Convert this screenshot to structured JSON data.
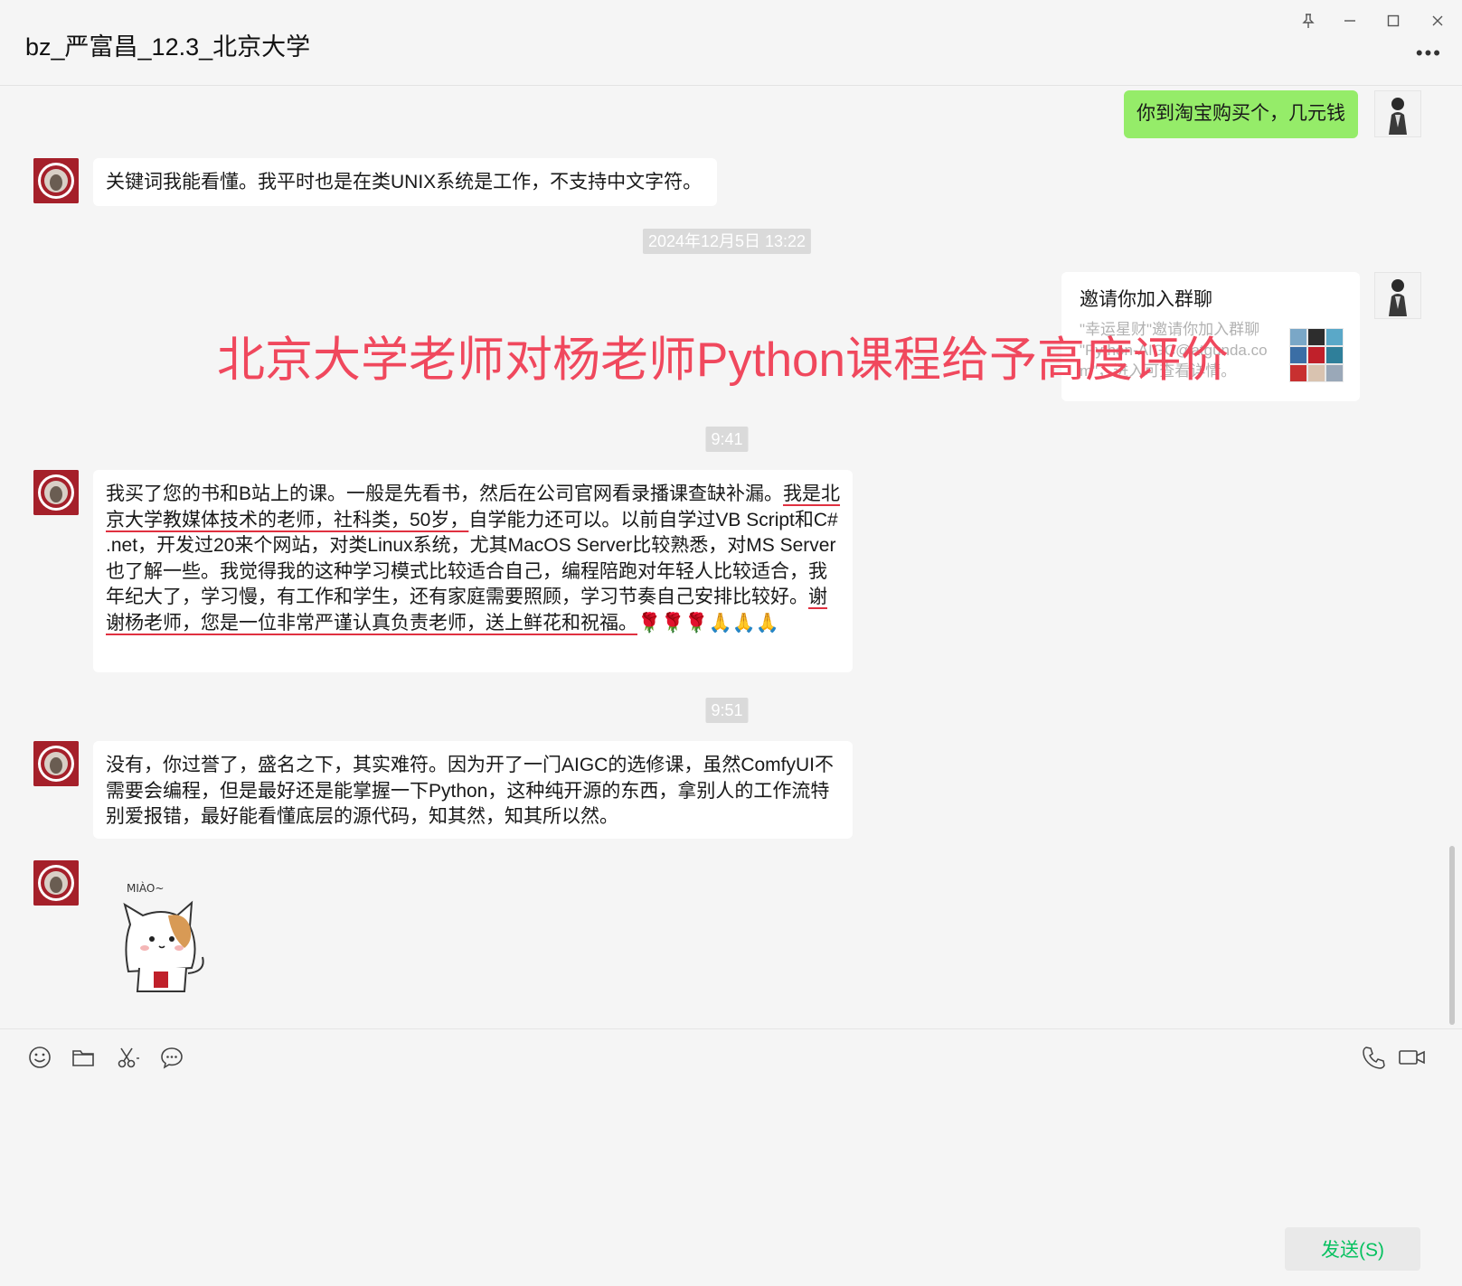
{
  "window": {
    "title": "bz_严富昌_12.3_北京大学"
  },
  "messages": {
    "m1_out": "你到淘宝购买个，几元钱",
    "m2_in": "关键词我能看懂。我平时也是在类UNIX系统是工作，不支持中文字符。",
    "ts1": "2024年12月5日 13:22",
    "invite": {
      "title": "邀请你加入群聊",
      "desc": "\"幸运星财\"邀请你加入群聊 \"Python-AIGC@atgunda.com\"，进入可查看详情。"
    },
    "ts2": "9:41",
    "m3": {
      "p1": "我买了您的书和B站上的课。一般是先看书，然后在公司官网看录播课查缺补漏。",
      "u1": "我是北京大学教媒体技术的老师，社科类，50岁，",
      "p2": "自学能力还可以。以前自学过VB Script和C# .net，开发过20来个网站，对类Linux系统，尤其MacOS Server比较熟悉，对MS Server也了解一些。我觉得我的这种学习模式比较适合自己，编程陪跑对年轻人比较适合，我年纪大了，学习慢，有工作和学生，还有家庭需要照顾，学习节奏自己安排比较好。",
      "u2": "谢谢杨老师，您是一位非常严谨认真负责老师，送上鲜花和祝福。",
      "emoji": "🌹🌹🌹🙏🙏🙏"
    },
    "ts3": "9:51",
    "m4": "没有，你过誉了，盛名之下，其实难符。因为开了一门AIGC的选修课，虽然ComfyUI不需要会编程，但是最好还是能掌握一下Python，这种纯开源的东西，拿别人的工作流特别爱报错，最好能看懂底层的源代码，知其然，知其所以然。",
    "sticker_text": "MIÀO~"
  },
  "overlay_caption": "北京大学老师对杨老师Python课程给予高度评价",
  "toolbar": {
    "icons": [
      "emoji-icon",
      "folder-icon",
      "scissors-icon",
      "chat-history-icon",
      "phone-icon",
      "video-icon"
    ]
  },
  "send_button": "发送(S)",
  "colors": {
    "outgoing_bubble": "#95ec69",
    "send_text": "#07c160",
    "overlay_text": "#f0485d",
    "underline": "#e03040"
  }
}
